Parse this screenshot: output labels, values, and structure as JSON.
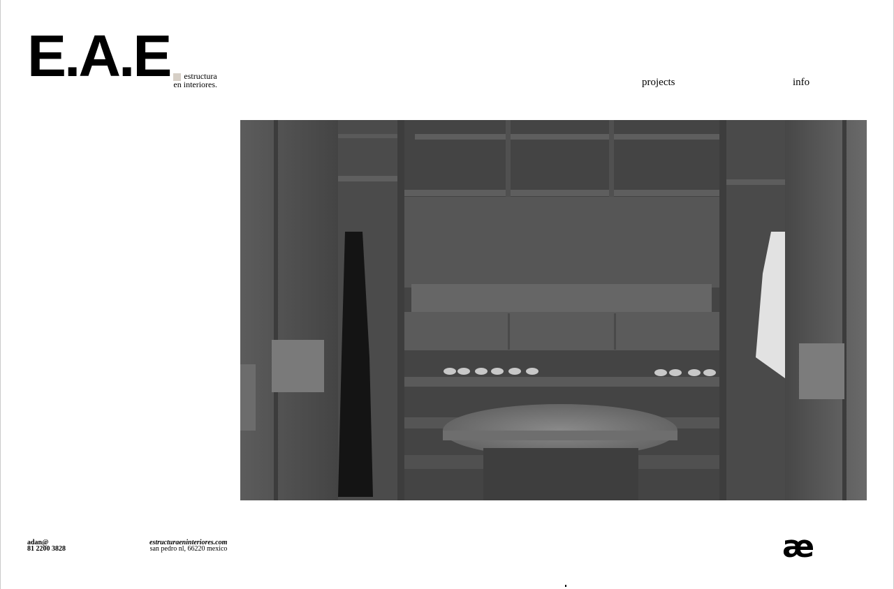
{
  "brand": {
    "mark": "E.A.E",
    "tagline_line1": "estructura",
    "tagline_line2": "en interiores.",
    "swatch_color": "#d6cfc6"
  },
  "nav": {
    "projects": "projects",
    "info": "info"
  },
  "hero": {
    "alt": "walk-in closet with dark wood shelving, shoes and a round marble island"
  },
  "footer": {
    "contact_line1": "adan@",
    "contact_line2": "81 2200 3828",
    "website": "estructuraeninteriores.com",
    "address": "san pedro nl, 66220 mexico",
    "glyph": "æ"
  }
}
